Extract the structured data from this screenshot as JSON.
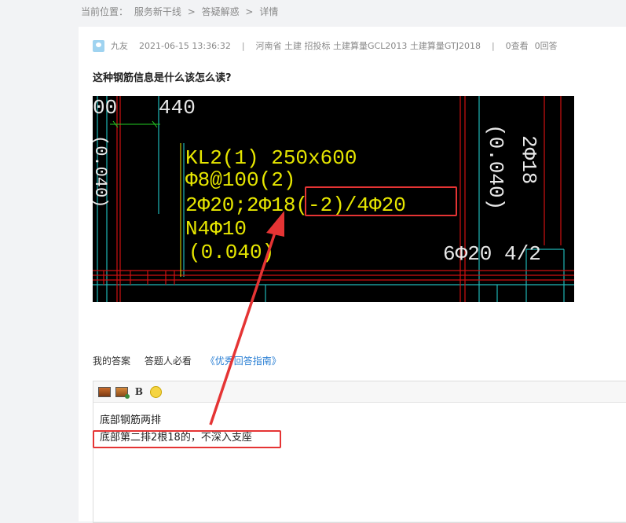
{
  "breadcrumb": {
    "label": "当前位置：",
    "items": [
      "服务新干线",
      ">",
      "答疑解惑",
      ">",
      "详情"
    ]
  },
  "meta": {
    "user": "九友",
    "time": "2021-06-15 13:36:32",
    "sep": "|",
    "tags": "河南省  土建 招投标 土建算量GCL2013 土建算量GTJ2018",
    "views": "0查看",
    "answers": "0回答"
  },
  "question": {
    "title": "这种钢筋信息是什么该怎么读?"
  },
  "cad_texts": {
    "top_left": "00",
    "top_num": "440",
    "left_vertical": "(0.040)",
    "right_vertical": "(0.040)",
    "right_rebar": "2Φ18",
    "kl": "KL2(1) 250x600",
    "stirrup": "Φ8@100(2)",
    "main_rebar": "2Φ20;2Φ18(-2)/4Φ20",
    "torsion": "N4Φ10",
    "elev": "(0.040)",
    "bottom_right": "6Φ20 4/2"
  },
  "tabs": {
    "my_answer": "我的答案",
    "must_read": "答题人必看",
    "guide_link": "《优秀回答指南》"
  },
  "editor": {
    "line1": "底部钢筋两排",
    "line2": "底部第二排2根18的，不深入支座"
  },
  "colors": {
    "annotation": "#e53434",
    "link": "#2a7fd4",
    "cad_yellow": "#e6e600",
    "cad_red": "#d01010",
    "cad_cyan": "#1fb6b6"
  }
}
